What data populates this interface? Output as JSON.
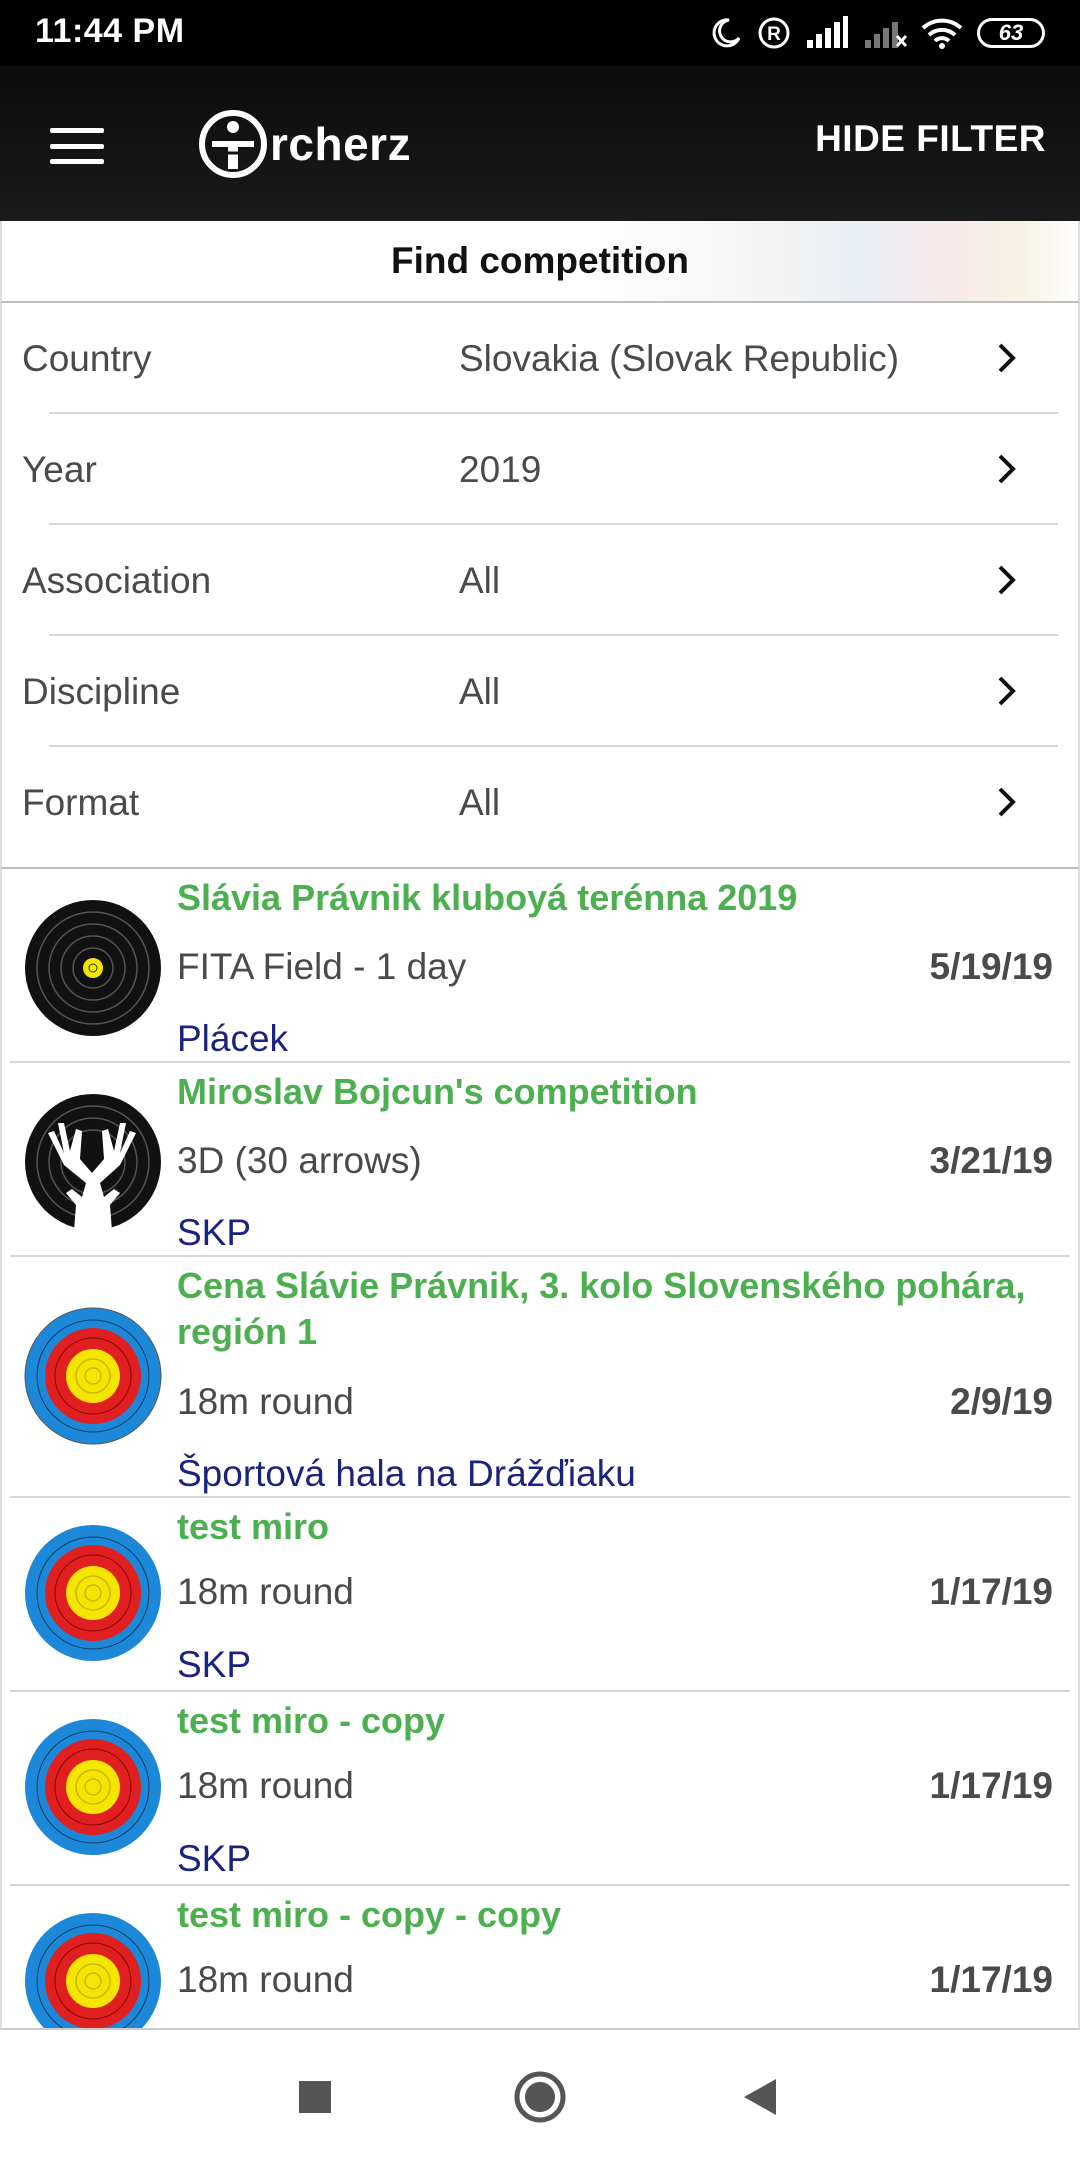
{
  "status_bar": {
    "time": "11:44 PM",
    "battery": "63"
  },
  "app_bar": {
    "logo_text": "rcherz",
    "hide_filter_label": "HIDE FILTER"
  },
  "filter_header": {
    "title": "Find competition"
  },
  "filters": [
    {
      "label": "Country",
      "value": "Slovakia (Slovak Republic)"
    },
    {
      "label": "Year",
      "value": "2019"
    },
    {
      "label": "Association",
      "value": "All"
    },
    {
      "label": "Discipline",
      "value": "All"
    },
    {
      "label": "Format",
      "value": "All"
    }
  ],
  "competitions": [
    {
      "name": "Slávia Právnik kluboyá terénna 2019",
      "format": "FITA Field - 1 day",
      "date": "5/19/19",
      "place": "Plácek",
      "icon": "field-target-icon"
    },
    {
      "name": "Miroslav Bojcun's competition",
      "format": "3D (30 arrows)",
      "date": "3/21/19",
      "place": "SKP",
      "icon": "deer-target-icon"
    },
    {
      "name": "Cena Slávie Právnik, 3. kolo Slovenského pohára, región 1",
      "format": "18m round",
      "date": "2/9/19",
      "place": "Športová hala na Drážďiaku",
      "icon": "target-face-icon"
    },
    {
      "name": "test miro",
      "format": "18m round",
      "date": "1/17/19",
      "place": "SKP",
      "icon": "target-face-icon"
    },
    {
      "name": "test miro - copy",
      "format": "18m round",
      "date": "1/17/19",
      "place": "SKP",
      "icon": "target-face-icon"
    },
    {
      "name": "test miro - copy - copy",
      "format": "18m round",
      "date": "1/17/19",
      "place": "",
      "icon": "target-face-icon"
    }
  ],
  "colors": {
    "competition_name": "#4caf50",
    "place": "#1a237e",
    "app_bar": "#111111"
  }
}
